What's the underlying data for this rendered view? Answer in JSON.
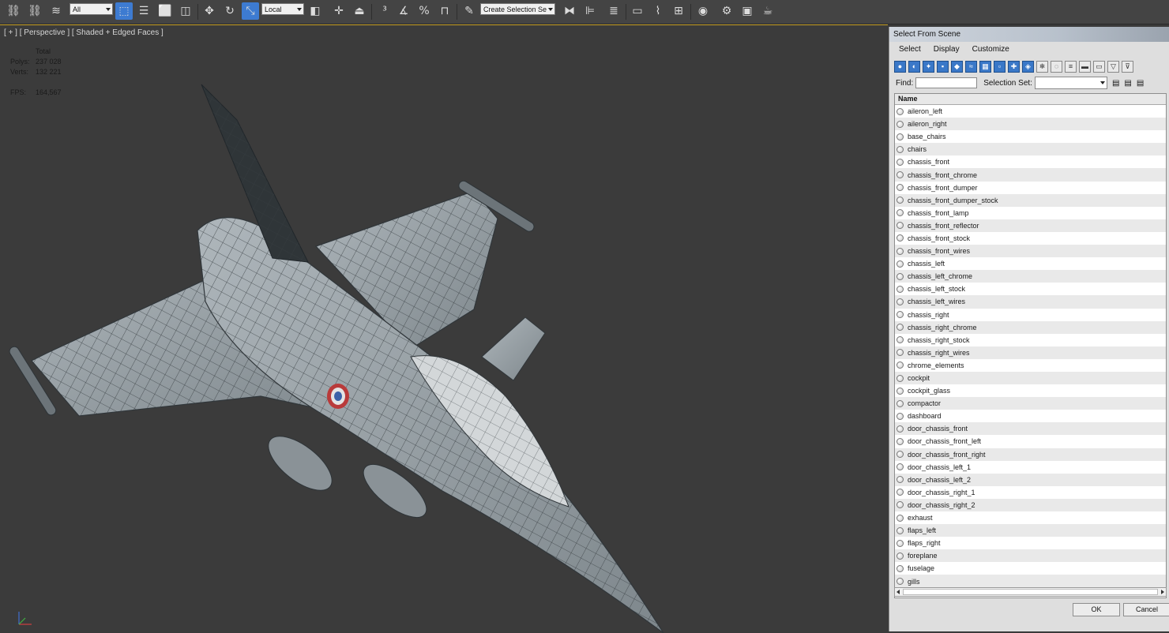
{
  "toolbar": {
    "filter_dropdown": "All",
    "coord_dropdown": "Local",
    "selection_set_placeholder": "Create Selection Se",
    "icons": [
      "link-icon",
      "unlink-icon",
      "bind-space-warp-icon",
      "select-object-icon",
      "select-by-name-icon",
      "rectangular-region-icon",
      "window-crossing-icon",
      "move-icon",
      "rotate-icon",
      "scale-icon",
      "mirror-select-icon",
      "use-pivot-icon",
      "select-manipulate-icon",
      "snap-3-icon",
      "angle-snap-icon",
      "percent-snap-icon",
      "spinner-snap-icon",
      "edit-named-selection-icon",
      "mirror-icon",
      "align-icon",
      "layer-manager-icon",
      "ribbon-icon",
      "curve-editor-icon",
      "schematic-view-icon",
      "material-editor-icon",
      "render-setup-icon",
      "render-frame-icon",
      "render-icon"
    ]
  },
  "viewport": {
    "label": "[ + ] [ Perspective ] [ Shaded + Edged Faces ]",
    "stats": {
      "total_label": "Total",
      "polys_label": "Polys:",
      "polys_value": "237 028",
      "verts_label": "Verts:",
      "verts_value": "132 221",
      "fps_label": "FPS:",
      "fps_value": "164,567"
    }
  },
  "dialog": {
    "title": "Select From Scene",
    "menu": [
      "Select",
      "Display",
      "Customize"
    ],
    "find_label": "Find:",
    "find_value": "",
    "selection_set_label": "Selection Set:",
    "column_header": "Name",
    "items": [
      "aileron_left",
      "aileron_right",
      "base_chairs",
      "chairs",
      "chassis_front",
      "chassis_front_chrome",
      "chassis_front_dumper",
      "chassis_front_dumper_stock",
      "chassis_front_lamp",
      "chassis_front_reflector",
      "chassis_front_stock",
      "chassis_front_wires",
      "chassis_left",
      "chassis_left_chrome",
      "chassis_left_stock",
      "chassis_left_wires",
      "chassis_right",
      "chassis_right_chrome",
      "chassis_right_stock",
      "chassis_right_wires",
      "chrome_elements",
      "cockpit",
      "cockpit_glass",
      "compactor",
      "dashboard",
      "door_chassis_front",
      "door_chassis_front_left",
      "door_chassis_front_right",
      "door_chassis_left_1",
      "door_chassis_left_2",
      "door_chassis_right_1",
      "door_chassis_right_2",
      "exhaust",
      "flaps_left",
      "flaps_right",
      "foreplane",
      "fuselage",
      "gills"
    ],
    "ok_label": "OK",
    "cancel_label": "Cancel"
  }
}
